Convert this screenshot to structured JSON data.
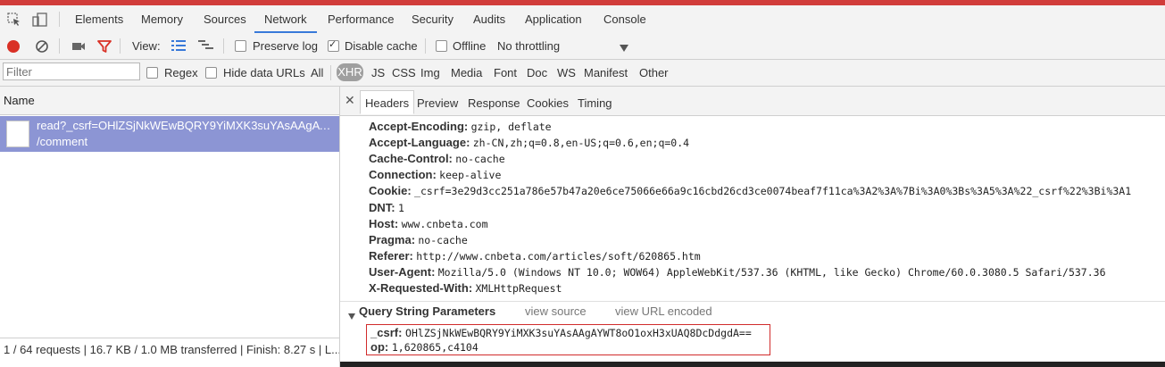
{
  "main_tabs": [
    "Elements",
    "Memory",
    "Sources",
    "Network",
    "Performance",
    "Security",
    "Audits",
    "Application",
    "Console"
  ],
  "active_tab": "Network",
  "toolbar": {
    "view_label": "View:",
    "preserve_log": "Preserve log",
    "disable_cache": "Disable cache",
    "offline": "Offline",
    "throttling": "No throttling"
  },
  "filter": {
    "placeholder": "Filter",
    "regex": "Regex",
    "hide_data_urls": "Hide data URLs",
    "types": [
      "All",
      "XHR",
      "JS",
      "CSS",
      "Img",
      "Media",
      "Font",
      "Doc",
      "WS",
      "Manifest",
      "Other"
    ],
    "selected_type": "XHR"
  },
  "requests": {
    "column_name": "Name",
    "items": [
      {
        "line1": "read?_csrf=OHlZSjNkWEwBQRY9YiMXK3suYAsAAgAYW...",
        "line2": "/comment"
      }
    ]
  },
  "status": {
    "text": "1 / 64 requests | 16.7 KB / 1.0 MB transferred | Finish: 8.27 s | L..."
  },
  "detail_tabs": [
    "Headers",
    "Preview",
    "Response",
    "Cookies",
    "Timing"
  ],
  "active_detail_tab": "Headers",
  "request_headers": [
    {
      "key": "Accept-Encoding:",
      "value": "gzip, deflate"
    },
    {
      "key": "Accept-Language:",
      "value": "zh-CN,zh;q=0.8,en-US;q=0.6,en;q=0.4"
    },
    {
      "key": "Cache-Control:",
      "value": "no-cache"
    },
    {
      "key": "Connection:",
      "value": "keep-alive"
    },
    {
      "key": "Cookie:",
      "value": "_csrf=3e29d3cc251a786e57b47a20e6ce75066e66a9c16cbd26cd3ce0074beaf7f11ca%3A2%3A%7Bi%3A0%3Bs%3A5%3A%22_csrf%22%3Bi%3A1"
    },
    {
      "key": "DNT:",
      "value": "1"
    },
    {
      "key": "Host:",
      "value": "www.cnbeta.com"
    },
    {
      "key": "Pragma:",
      "value": "no-cache"
    },
    {
      "key": "Referer:",
      "value": "http://www.cnbeta.com/articles/soft/620865.htm"
    },
    {
      "key": "User-Agent:",
      "value": "Mozilla/5.0 (Windows NT 10.0; WOW64) AppleWebKit/537.36 (KHTML, like Gecko) Chrome/60.0.3080.5 Safari/537.36"
    },
    {
      "key": "X-Requested-With:",
      "value": "XMLHttpRequest"
    }
  ],
  "query_string": {
    "title": "Query String Parameters",
    "view_source": "view source",
    "view_url_encoded": "view URL encoded",
    "params": [
      {
        "key": "_csrf:",
        "value": "OHlZSjNkWEwBQRY9YiMXK3suYAsAAgAYWT8oO1oxH3xUAQ8DcDdgdA=="
      },
      {
        "key": "op:",
        "value": "1,620865,c4104"
      }
    ]
  }
}
